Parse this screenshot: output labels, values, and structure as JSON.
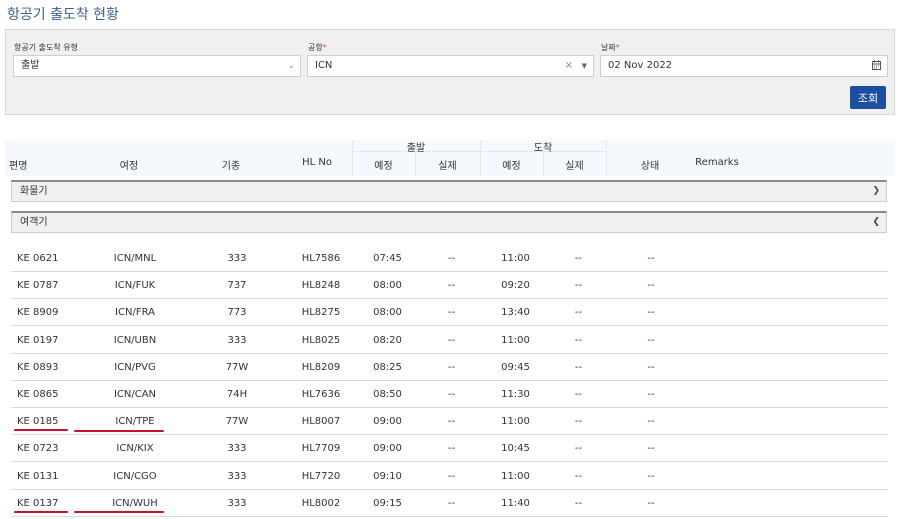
{
  "page": {
    "title": "항공기 출도착 현황"
  },
  "filters": {
    "type": {
      "label": "항공기 출도착 유형",
      "value": "출발"
    },
    "airport": {
      "label": "공항",
      "value": "ICN"
    },
    "date": {
      "label": "날짜",
      "value": "02 Nov 2022"
    },
    "required_mark": "*",
    "clear_icon": "×",
    "search_button": "조회"
  },
  "table": {
    "headers": {
      "flight": "편명",
      "route": "여정",
      "aircraft": "기종",
      "hlno": "HL No",
      "departure": "출발",
      "arrival": "도착",
      "dep_sched": "예정",
      "dep_actual": "실제",
      "arr_sched": "예정",
      "arr_actual": "실제",
      "status": "상태",
      "remarks": "Remarks"
    },
    "groups": {
      "cargo": {
        "label": "화물기",
        "icon": "chevron-down"
      },
      "passenger": {
        "label": "여객기",
        "icon": "chevron-up"
      }
    },
    "rows": [
      {
        "flight": "KE 0621",
        "route": "ICN/MNL",
        "aircraft": "333",
        "hlno": "HL7586",
        "dep_sched": "07:45",
        "dep_actual": "--",
        "arr_sched": "11:00",
        "arr_actual": "--",
        "status": "--",
        "remarks": ""
      },
      {
        "flight": "KE 0787",
        "route": "ICN/FUK",
        "aircraft": "737",
        "hlno": "HL8248",
        "dep_sched": "08:00",
        "dep_actual": "--",
        "arr_sched": "09:20",
        "arr_actual": "--",
        "status": "--",
        "remarks": ""
      },
      {
        "flight": "KE 8909",
        "route": "ICN/FRA",
        "aircraft": "773",
        "hlno": "HL8275",
        "dep_sched": "08:00",
        "dep_actual": "--",
        "arr_sched": "13:40",
        "arr_actual": "--",
        "status": "--",
        "remarks": ""
      },
      {
        "flight": "KE 0197",
        "route": "ICN/UBN",
        "aircraft": "333",
        "hlno": "HL8025",
        "dep_sched": "08:20",
        "dep_actual": "--",
        "arr_sched": "11:00",
        "arr_actual": "--",
        "status": "--",
        "remarks": ""
      },
      {
        "flight": "KE 0893",
        "route": "ICN/PVG",
        "aircraft": "77W",
        "hlno": "HL8209",
        "dep_sched": "08:25",
        "dep_actual": "--",
        "arr_sched": "09:45",
        "arr_actual": "--",
        "status": "--",
        "remarks": ""
      },
      {
        "flight": "KE 0865",
        "route": "ICN/CAN",
        "aircraft": "74H",
        "hlno": "HL7636",
        "dep_sched": "08:50",
        "dep_actual": "--",
        "arr_sched": "11:30",
        "arr_actual": "--",
        "status": "--",
        "remarks": ""
      },
      {
        "flight": "KE 0185",
        "route": "ICN/TPE",
        "aircraft": "77W",
        "hlno": "HL8007",
        "dep_sched": "09:00",
        "dep_actual": "--",
        "arr_sched": "11:00",
        "arr_actual": "--",
        "status": "--",
        "remarks": ""
      },
      {
        "flight": "KE 0723",
        "route": "ICN/KIX",
        "aircraft": "333",
        "hlno": "HL7709",
        "dep_sched": "09:00",
        "dep_actual": "--",
        "arr_sched": "10:45",
        "arr_actual": "--",
        "status": "--",
        "remarks": ""
      },
      {
        "flight": "KE 0131",
        "route": "ICN/CGO",
        "aircraft": "333",
        "hlno": "HL7720",
        "dep_sched": "09:10",
        "dep_actual": "--",
        "arr_sched": "11:00",
        "arr_actual": "--",
        "status": "--",
        "remarks": ""
      },
      {
        "flight": "KE 0137",
        "route": "ICN/WUH",
        "aircraft": "333",
        "hlno": "HL8002",
        "dep_sched": "09:15",
        "dep_actual": "--",
        "arr_sched": "11:40",
        "arr_actual": "--",
        "status": "--",
        "remarks": ""
      }
    ]
  },
  "colors": {
    "accent": "#1d4fa0",
    "title": "#3a5f8f",
    "required": "#d9534f",
    "underline": "#c8102e"
  }
}
